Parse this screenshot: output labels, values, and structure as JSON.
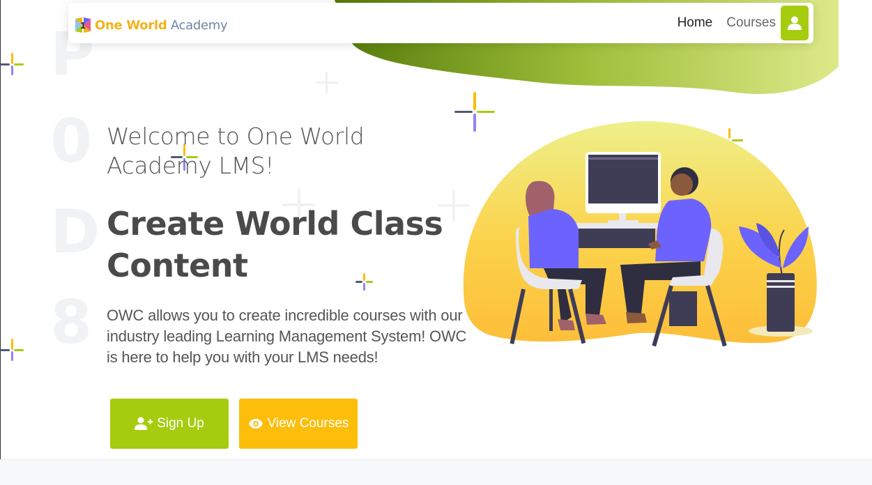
{
  "navbar": {
    "logo_badge": "1",
    "logo_text_1": "One World",
    "logo_text_2": " Academy",
    "links": [
      "Home",
      "Courses"
    ],
    "user_icon": "user-icon"
  },
  "hero": {
    "welcome": "Welcome to One World Academy LMS!",
    "headline": "Create World Class Content",
    "description": "OWC allows you to create incredible courses with our industry leading Learning Management System! OWC is here to help you with your LMS needs!",
    "buttons": {
      "signup_label": "Sign Up",
      "signup_icon": "user-plus-icon",
      "view_label": "View Courses",
      "view_icon": "eye-icon"
    }
  },
  "watermark_letters": [
    "P",
    "0",
    "D",
    "8"
  ],
  "colors": {
    "primary_green": "#a6cc10",
    "accent_yellow": "#fdbd0b",
    "illustration_purple": "#6c63ff",
    "wave_dark_green": "#5b7a0e"
  }
}
